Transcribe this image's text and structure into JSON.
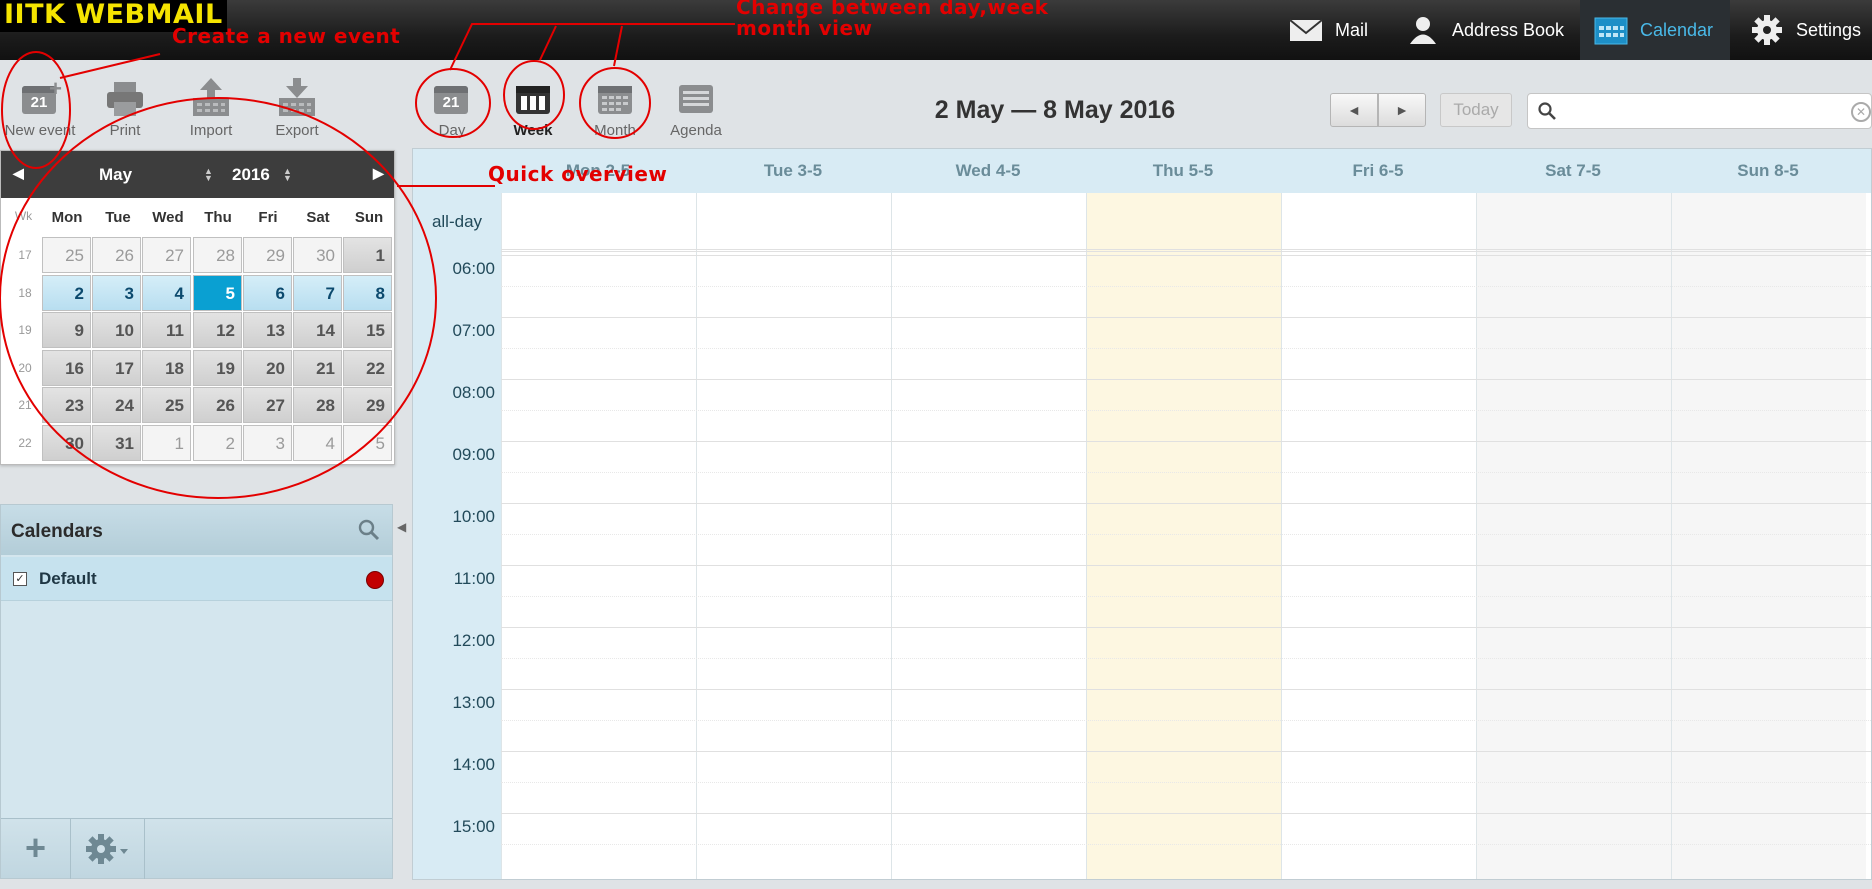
{
  "brand": "IITK WEBMAIL",
  "topnav": {
    "mail": "Mail",
    "addressbook": "Address Book",
    "calendar": "Calendar",
    "settings": "Settings"
  },
  "toolbar": {
    "new_event": "New event",
    "print": "Print",
    "import": "Import",
    "export": "Export",
    "day": "Day",
    "week": "Week",
    "month": "Month",
    "agenda": "Agenda",
    "calendar_icon_number": "21"
  },
  "date_range": "2 May — 8 May 2016",
  "nav": {
    "prev": "◄",
    "next": "►",
    "today": "Today"
  },
  "search": {
    "placeholder": "",
    "clear": "✕"
  },
  "mini_calendar": {
    "month": "May",
    "year": "2016",
    "week_label": "Wk",
    "dows": [
      "Mon",
      "Tue",
      "Wed",
      "Thu",
      "Fri",
      "Sat",
      "Sun"
    ],
    "weeks": [
      {
        "wk": "17",
        "days": [
          "25",
          "26",
          "27",
          "28",
          "29",
          "30",
          "1"
        ]
      },
      {
        "wk": "18",
        "days": [
          "2",
          "3",
          "4",
          "5",
          "6",
          "7",
          "8"
        ]
      },
      {
        "wk": "19",
        "days": [
          "9",
          "10",
          "11",
          "12",
          "13",
          "14",
          "15"
        ]
      },
      {
        "wk": "20",
        "days": [
          "16",
          "17",
          "18",
          "19",
          "20",
          "21",
          "22"
        ]
      },
      {
        "wk": "21",
        "days": [
          "23",
          "24",
          "25",
          "26",
          "27",
          "28",
          "29"
        ]
      },
      {
        "wk": "22",
        "days": [
          "30",
          "31",
          "1",
          "2",
          "3",
          "4",
          "5"
        ]
      }
    ]
  },
  "calendars": {
    "title": "Calendars",
    "items": [
      {
        "name": "Default",
        "color": "#c20000",
        "checked": true
      }
    ],
    "add": "+"
  },
  "week_view": {
    "days": [
      "Mon 2-5",
      "Tue 3-5",
      "Wed 4-5",
      "Thu 5-5",
      "Fri 6-5",
      "Sat 7-5",
      "Sun 8-5"
    ],
    "allday_label": "all-day",
    "hours": [
      "06:00",
      "07:00",
      "08:00",
      "09:00",
      "10:00",
      "11:00",
      "12:00",
      "13:00",
      "14:00",
      "15:00"
    ]
  },
  "annotations": {
    "new_event": "Create a new event",
    "views_line1": "Change between day,week",
    "views_line2": "month view",
    "overview": "Quick overview"
  },
  "colors": {
    "accent": "#0aa0d2",
    "annotation": "#e30000",
    "brand_text": "#f5e400",
    "today_column": "#fdf7e1"
  }
}
